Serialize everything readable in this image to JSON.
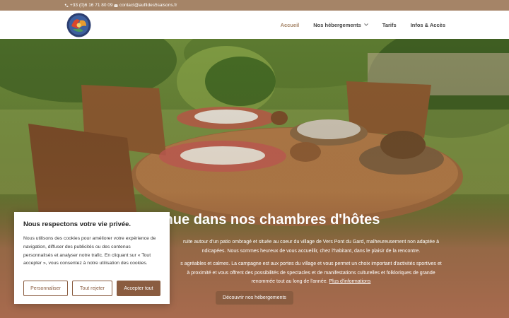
{
  "topbar": {
    "phone": "+33 (0)6 16 71 80 09",
    "email": "contact@aufildes5saisons.fr"
  },
  "nav": {
    "items": [
      {
        "label": "Accueil",
        "active": true
      },
      {
        "label": "Nos hébergements",
        "dropdown": true
      },
      {
        "label": "Tarifs"
      },
      {
        "label": "Infos & Accès"
      }
    ]
  },
  "hero": {
    "title": "nue dans nos chambres d'hôtes",
    "p1_line1": "ruite autour d'un patio ombragé et située au coeur du village de Vers Pont du Gard, malheureusement non adaptée à",
    "p1_line2": "ndicapées. Nous sommes heureux de vous accueillir, chez l'habitant, dans le plaisir de la rencontre.",
    "p2_line1": "s agréables et calmes. La campagne est aux portes du village et vous permet un choix important d'activités sportives et",
    "p2_line2": "à proximité et vous offrent des possibilités de spectacles et de manifestations culturelles et folkloriques de grande",
    "p2_line3_text": "renommée tout au long de l'année.",
    "p2_link": "Plus d'informations",
    "button": "Découvrir nos hébergements"
  },
  "cookie": {
    "title": "Nous respectons votre vie privée.",
    "text": "Nous utilisons des cookies pour améliorer votre expérience de navigation, diffuser des publicités ou des contenus personnalisés et analyser notre trafic. En cliquant sur « Tout accepter », vous consentez à notre utilisation des cookies.",
    "btn_customize": "Personnaliser",
    "btn_reject": "Tout rejeter",
    "btn_accept": "Accepter tout"
  },
  "colors": {
    "brand": "#a58467",
    "button": "#8a5c40"
  }
}
